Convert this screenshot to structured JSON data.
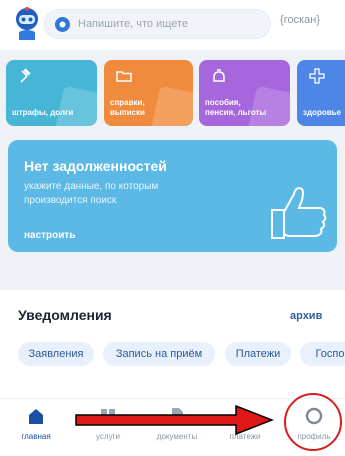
{
  "search": {
    "placeholder": "Напишите, что ищете",
    "scan_label": "госкан"
  },
  "tiles": [
    {
      "label": "штрафы, долги",
      "color": "#47b6d6",
      "icon": "gavel-icon"
    },
    {
      "label": "справки,\nвыписки",
      "color": "#f08a3c",
      "icon": "folder-icon"
    },
    {
      "label": "пособия,\nпенсия, льготы",
      "color": "#a666dc",
      "icon": "piggy-bank-icon"
    },
    {
      "label": "здоровье",
      "color": "#4e86e8",
      "icon": "medical-cross-icon"
    }
  ],
  "banner": {
    "title": "Нет задолженностей",
    "text": "укажите данные, по которым производится поиск",
    "link": "настроить",
    "icon": "thumbs-up-icon"
  },
  "notifications": {
    "title": "Уведомления",
    "archive": "архив",
    "chips": [
      "Заявления",
      "Запись на приём",
      "Платежи",
      "Госпо"
    ]
  },
  "tabbar": [
    {
      "label": "главная",
      "icon": "home-icon",
      "active": true
    },
    {
      "label": "услуги",
      "icon": "grid-icon",
      "active": false
    },
    {
      "label": "документы",
      "icon": "document-icon",
      "active": false
    },
    {
      "label": "платежи",
      "icon": "wallet-icon",
      "active": false
    },
    {
      "label": "профиль",
      "icon": "profile-icon",
      "active": false
    }
  ],
  "colors": {
    "accent": "#1a4fa3",
    "annotation": "#d62020",
    "banner": "#5cb8e4"
  }
}
